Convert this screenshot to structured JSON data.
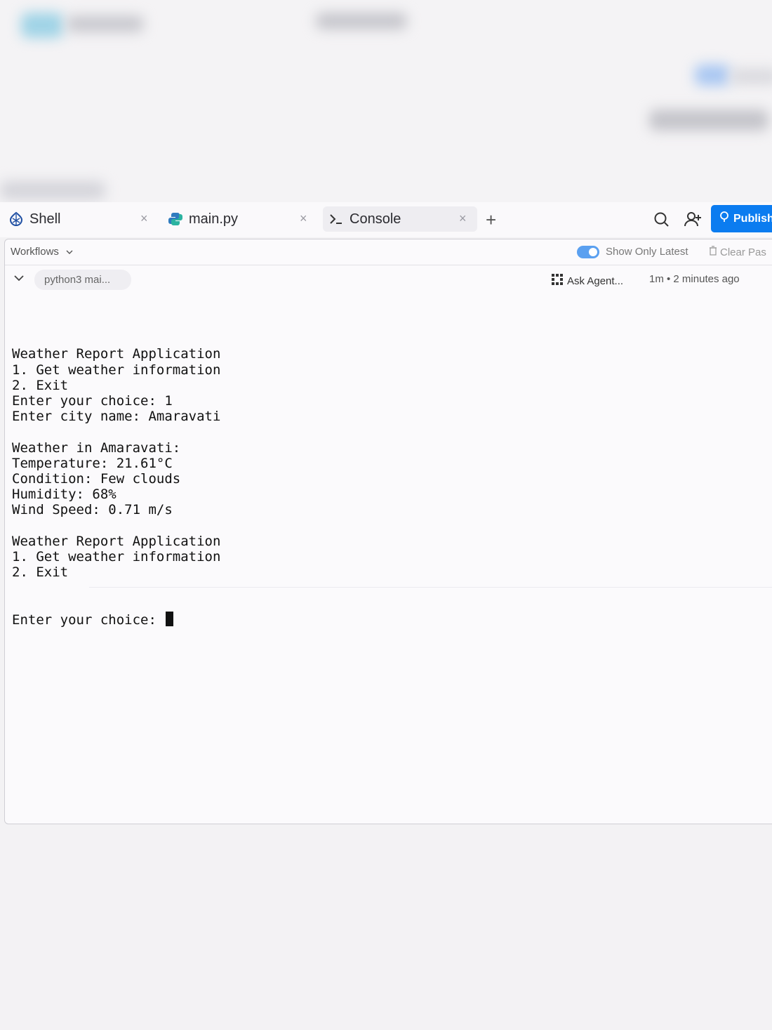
{
  "tabs": {
    "shell": {
      "label": "Shell"
    },
    "main": {
      "label": "main.py"
    },
    "console": {
      "label": "Console"
    }
  },
  "toolbar": {
    "publish_label": "Publish"
  },
  "workflows_bar": {
    "workflows_label": "Workflows",
    "show_latest_label": "Show Only Latest",
    "show_latest_on": true,
    "clear_label": "Clear Pas"
  },
  "run": {
    "command": "python3 mai...",
    "ask_agent": "Ask Agent...",
    "time": "1m • 2 minutes ago"
  },
  "console": {
    "lines": [
      "Weather Report Application",
      "1. Get weather information",
      "2. Exit",
      "Enter your choice: 1",
      "Enter city name: Amaravati",
      "",
      "Weather in Amaravati:",
      "Temperature: 21.61°C",
      "Condition: Few clouds",
      "Humidity: 68%",
      "Wind Speed: 0.71 m/s",
      "",
      "Weather Report Application",
      "1. Get weather information",
      "2. Exit"
    ],
    "prompt": "Enter your choice: "
  },
  "colors": {
    "accent": "#0b7cf0",
    "toggle": "#5aa0f0"
  }
}
